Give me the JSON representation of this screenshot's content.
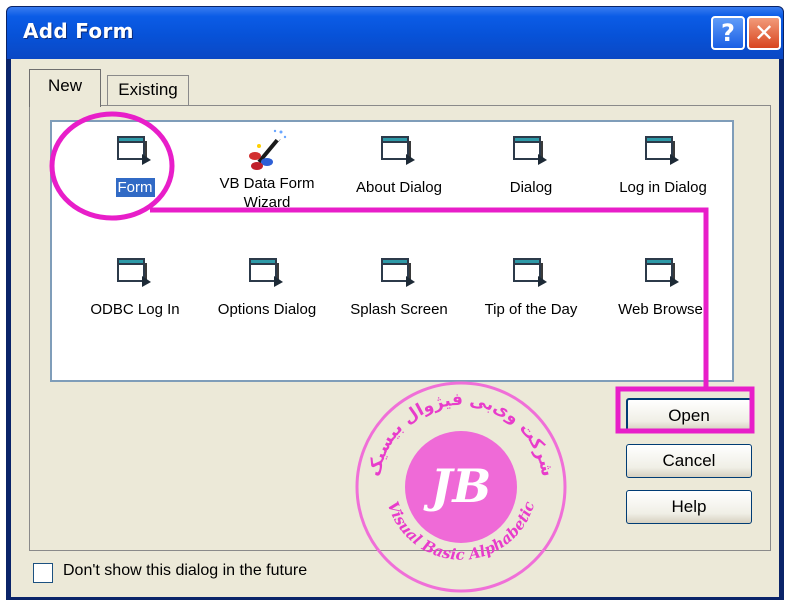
{
  "window": {
    "title": "Add Form",
    "help_glyph": "?",
    "close_glyph": "✕"
  },
  "tabs": [
    {
      "label": "New"
    },
    {
      "label": "Existing"
    }
  ],
  "items": [
    {
      "label": "Form",
      "icon": "form-icon"
    },
    {
      "label": "VB Data Form Wizard",
      "icon": "wizard-icon"
    },
    {
      "label": "About Dialog",
      "icon": "form-icon"
    },
    {
      "label": "Dialog",
      "icon": "form-icon"
    },
    {
      "label": "Log in Dialog",
      "icon": "form-icon"
    },
    {
      "label": "ODBC Log In",
      "icon": "form-icon"
    },
    {
      "label": "Options Dialog",
      "icon": "form-icon"
    },
    {
      "label": "Splash Screen",
      "icon": "form-icon"
    },
    {
      "label": "Tip of the Day",
      "icon": "form-icon"
    },
    {
      "label": "Web Browser",
      "icon": "form-icon"
    }
  ],
  "buttons": {
    "open": "Open",
    "cancel": "Cancel",
    "help": "Help"
  },
  "checkbox": {
    "label": "Don't show this dialog in the future",
    "checked": false
  },
  "watermark": {
    "monogram": "JB",
    "arc_top": "شرکت وی‌بی فیژوال بیسیک",
    "arc_bottom": "Visual Basic Alphabetic"
  },
  "colors": {
    "highlight": "#e81ec9",
    "selection": "#316ac5",
    "title_bar": "#0752d8"
  }
}
